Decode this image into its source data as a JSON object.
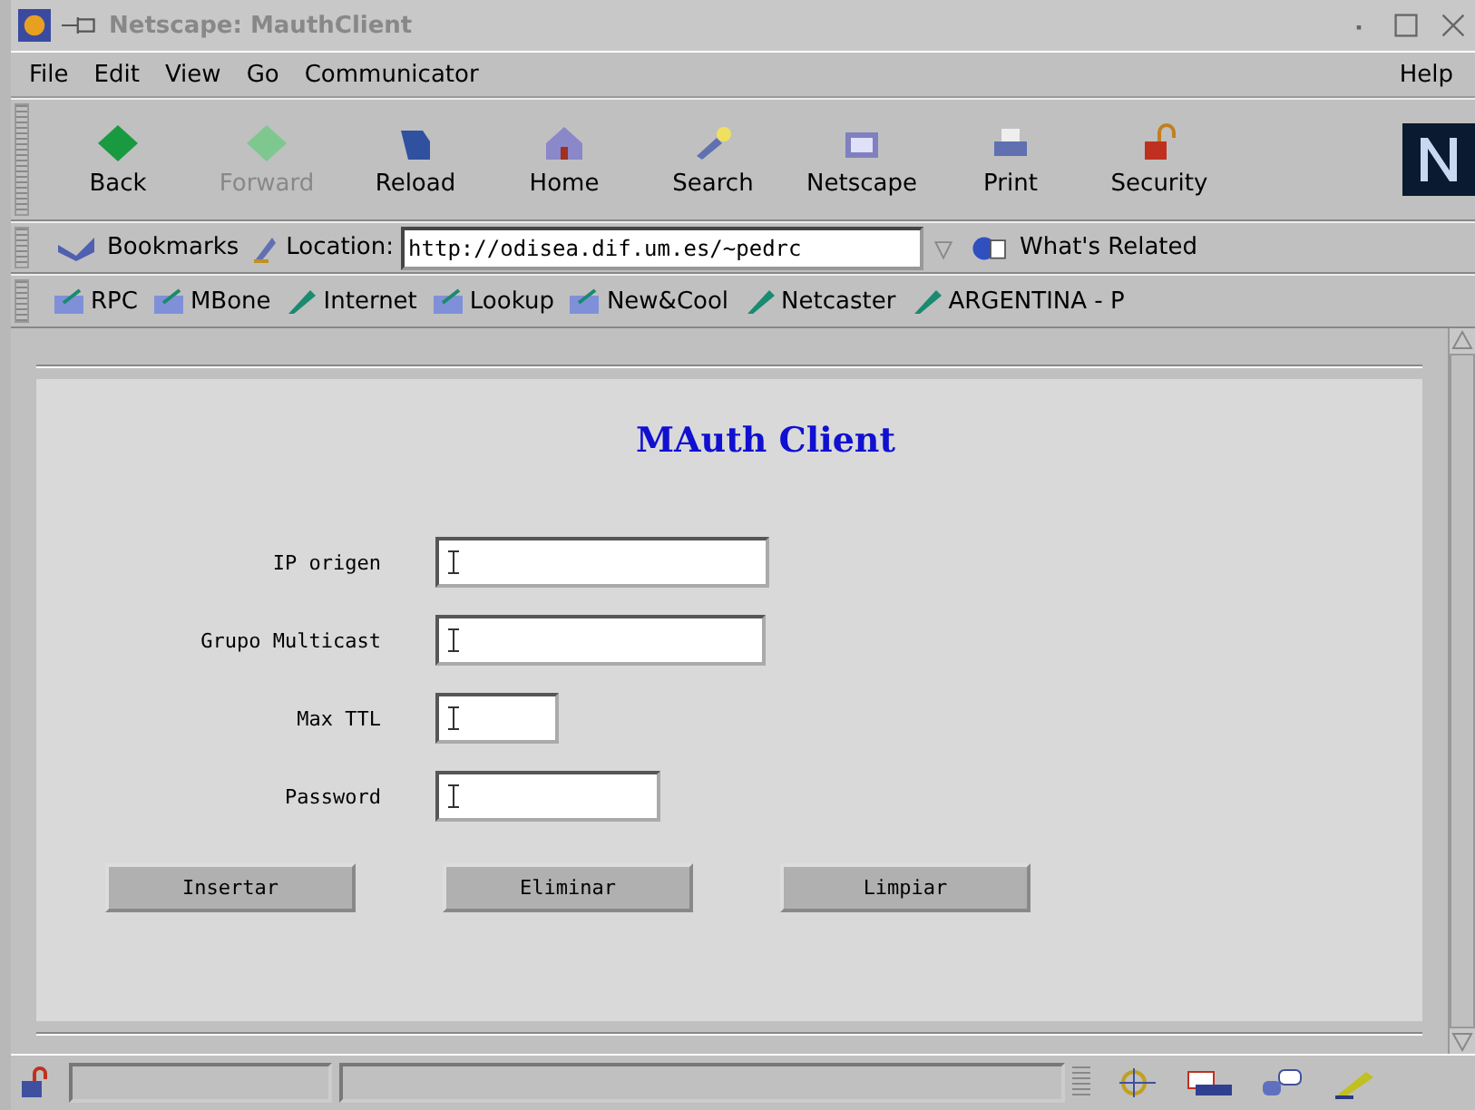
{
  "window": {
    "title": "Netscape: MauthClient"
  },
  "menu": [
    "File",
    "Edit",
    "View",
    "Go",
    "Communicator"
  ],
  "help_menu": "Help",
  "toolbar": [
    {
      "label": "Back",
      "disabled": false
    },
    {
      "label": "Forward",
      "disabled": true
    },
    {
      "label": "Reload",
      "disabled": false
    },
    {
      "label": "Home",
      "disabled": false
    },
    {
      "label": "Search",
      "disabled": false
    },
    {
      "label": "Netscape",
      "disabled": false
    },
    {
      "label": "Print",
      "disabled": false
    },
    {
      "label": "Security",
      "disabled": false
    }
  ],
  "location_bar": {
    "bookmarks": "Bookmarks",
    "location_label": "Location:",
    "url": "http://odisea.dif.um.es/~pedrc",
    "related": "What's Related"
  },
  "personal_toolbar": [
    {
      "label": "RPC",
      "kind": "folder"
    },
    {
      "label": "MBone",
      "kind": "folder"
    },
    {
      "label": "Internet",
      "kind": "link"
    },
    {
      "label": "Lookup",
      "kind": "folder"
    },
    {
      "label": "New&Cool",
      "kind": "folder"
    },
    {
      "label": "Netcaster",
      "kind": "link"
    },
    {
      "label": "ARGENTINA - P",
      "kind": "link"
    }
  ],
  "page": {
    "heading": "MAuth Client",
    "fields": [
      {
        "label": "IP origen"
      },
      {
        "label": "Grupo Multicast"
      },
      {
        "label": "Max TTL"
      },
      {
        "label": "Password"
      }
    ],
    "buttons": [
      "Insertar",
      "Eliminar",
      "Limpiar"
    ]
  }
}
